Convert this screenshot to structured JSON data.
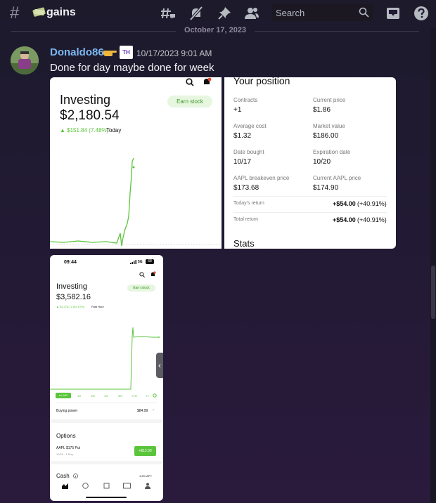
{
  "header": {
    "channel_name": "gains",
    "search_placeholder": "Search",
    "icons": [
      "threads-icon",
      "notification-mute-icon",
      "pin-icon",
      "members-icon",
      "search-icon",
      "inbox-icon",
      "help-icon"
    ]
  },
  "chat": {
    "date_divider": "October 17, 2023",
    "message": {
      "username": "Donaldo86",
      "badge": "TH",
      "timestamp": "10/17/2023 9:01 AM",
      "text": "Done for day maybe done for week"
    }
  },
  "attachments": {
    "first": {
      "title": "Investing",
      "value": "$2,180.54",
      "change": "▲ $151.84 (7.48%)",
      "change_period": "Today",
      "earn_button": "Earn stock",
      "accent": "#5ac53b"
    },
    "second": {
      "heading": "Your position",
      "fields": [
        {
          "label": "Contracts",
          "value": "+1"
        },
        {
          "label": "Current price",
          "value": "$1.86"
        },
        {
          "label": "Average cost",
          "value": "$1.32"
        },
        {
          "label": "Market value",
          "value": "$186.00"
        },
        {
          "label": "Date bought",
          "value": "10/17"
        },
        {
          "label": "Expiration date",
          "value": "10/20"
        },
        {
          "label": "AAPL breakeven price",
          "value": "$173.68"
        },
        {
          "label": "Current AAPL price",
          "value": "$174.90"
        }
      ],
      "todays_return_label": "Today's return",
      "todays_return_value": "+$54.00",
      "todays_return_pct": "(+40.91%)",
      "total_return_label": "Total return",
      "total_return_value": "+$54.00",
      "total_return_pct": "(+40.91%)",
      "stats_heading": "Stats"
    },
    "third": {
      "time": "09:44",
      "network": "5G",
      "battery": "68",
      "title": "Investing",
      "value": "$3,582.16",
      "change": "▲ $1,378.72 (62.57%)",
      "change_period": "Past Hour",
      "earn_button": "Earn stock",
      "ranges": [
        "● LIVE",
        "1D",
        "1W",
        "1M",
        "3M",
        "YTD",
        "1Y"
      ],
      "buying_power_label": "Buying power",
      "buying_power_value": "$84.99",
      "options_heading": "Options",
      "option_name": "AAPL $175 Put",
      "option_sub": "10/20 · 1 Buy",
      "option_value": "+$12.00",
      "cash_label": "Cash",
      "cash_apy": "1.5% APY"
    }
  }
}
